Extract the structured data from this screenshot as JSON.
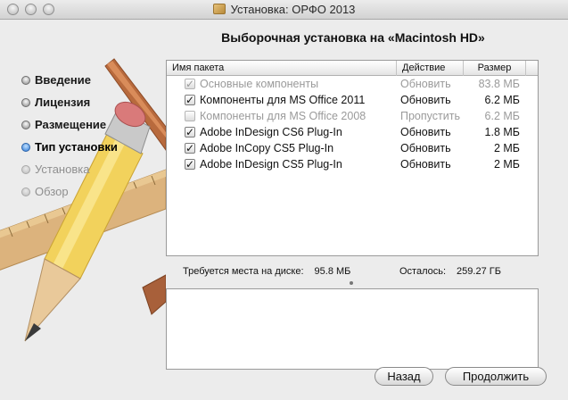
{
  "window": {
    "title": "Установка: ОРФО 2013"
  },
  "heading": "Выборочная установка на «Macintosh HD»",
  "steps": [
    {
      "label": "Введение",
      "state": "done"
    },
    {
      "label": "Лицензия",
      "state": "done"
    },
    {
      "label": "Размещение",
      "state": "done"
    },
    {
      "label": "Тип установки",
      "state": "current"
    },
    {
      "label": "Установка",
      "state": "pending"
    },
    {
      "label": "Обзор",
      "state": "pending"
    }
  ],
  "table": {
    "columns": {
      "name": "Имя пакета",
      "action": "Действие",
      "size": "Размер"
    },
    "rows": [
      {
        "name": "Основные компоненты",
        "action": "Обновить",
        "size": "83.8 МБ",
        "checked": true,
        "enabled": false
      },
      {
        "name": "Компоненты для MS Office 2011",
        "action": "Обновить",
        "size": "6.2 МБ",
        "checked": true,
        "enabled": true
      },
      {
        "name": "Компоненты для MS Office 2008",
        "action": "Пропустить",
        "size": "6.2 МБ",
        "checked": false,
        "enabled": false
      },
      {
        "name": "Adobe InDesign CS6 Plug-In",
        "action": "Обновить",
        "size": "1.8 МБ",
        "checked": true,
        "enabled": true
      },
      {
        "name": "Adobe InCopy CS5 Plug-In",
        "action": "Обновить",
        "size": "2 МБ",
        "checked": true,
        "enabled": true
      },
      {
        "name": "Adobe InDesign CS5 Plug-In",
        "action": "Обновить",
        "size": "2 МБ",
        "checked": true,
        "enabled": true
      }
    ]
  },
  "disk": {
    "required_label": "Требуется места на диске:",
    "required_value": "95.8 МБ",
    "remaining_label": "Осталось:",
    "remaining_value": "259.27 ГБ"
  },
  "buttons": {
    "back": "Назад",
    "continue": "Продолжить"
  },
  "icons": {
    "window": "package-icon",
    "step": "step-bullet-icon",
    "checkbox": "checkmark-icon"
  },
  "colors": {
    "current_step": "#2f7bd6",
    "disabled_text": "#9a9a9a"
  }
}
